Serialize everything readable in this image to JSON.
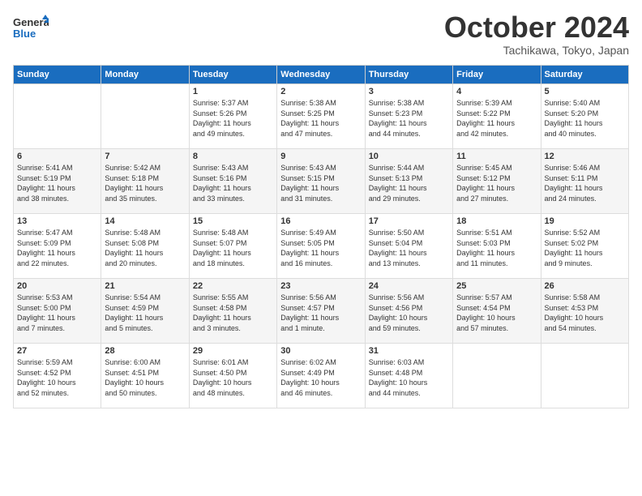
{
  "logo": {
    "general": "General",
    "blue": "Blue"
  },
  "header": {
    "month": "October 2024",
    "location": "Tachikawa, Tokyo, Japan"
  },
  "weekdays": [
    "Sunday",
    "Monday",
    "Tuesday",
    "Wednesday",
    "Thursday",
    "Friday",
    "Saturday"
  ],
  "weeks": [
    [
      {
        "day": "",
        "info": ""
      },
      {
        "day": "",
        "info": ""
      },
      {
        "day": "1",
        "info": "Sunrise: 5:37 AM\nSunset: 5:26 PM\nDaylight: 11 hours\nand 49 minutes."
      },
      {
        "day": "2",
        "info": "Sunrise: 5:38 AM\nSunset: 5:25 PM\nDaylight: 11 hours\nand 47 minutes."
      },
      {
        "day": "3",
        "info": "Sunrise: 5:38 AM\nSunset: 5:23 PM\nDaylight: 11 hours\nand 44 minutes."
      },
      {
        "day": "4",
        "info": "Sunrise: 5:39 AM\nSunset: 5:22 PM\nDaylight: 11 hours\nand 42 minutes."
      },
      {
        "day": "5",
        "info": "Sunrise: 5:40 AM\nSunset: 5:20 PM\nDaylight: 11 hours\nand 40 minutes."
      }
    ],
    [
      {
        "day": "6",
        "info": "Sunrise: 5:41 AM\nSunset: 5:19 PM\nDaylight: 11 hours\nand 38 minutes."
      },
      {
        "day": "7",
        "info": "Sunrise: 5:42 AM\nSunset: 5:18 PM\nDaylight: 11 hours\nand 35 minutes."
      },
      {
        "day": "8",
        "info": "Sunrise: 5:43 AM\nSunset: 5:16 PM\nDaylight: 11 hours\nand 33 minutes."
      },
      {
        "day": "9",
        "info": "Sunrise: 5:43 AM\nSunset: 5:15 PM\nDaylight: 11 hours\nand 31 minutes."
      },
      {
        "day": "10",
        "info": "Sunrise: 5:44 AM\nSunset: 5:13 PM\nDaylight: 11 hours\nand 29 minutes."
      },
      {
        "day": "11",
        "info": "Sunrise: 5:45 AM\nSunset: 5:12 PM\nDaylight: 11 hours\nand 27 minutes."
      },
      {
        "day": "12",
        "info": "Sunrise: 5:46 AM\nSunset: 5:11 PM\nDaylight: 11 hours\nand 24 minutes."
      }
    ],
    [
      {
        "day": "13",
        "info": "Sunrise: 5:47 AM\nSunset: 5:09 PM\nDaylight: 11 hours\nand 22 minutes."
      },
      {
        "day": "14",
        "info": "Sunrise: 5:48 AM\nSunset: 5:08 PM\nDaylight: 11 hours\nand 20 minutes."
      },
      {
        "day": "15",
        "info": "Sunrise: 5:48 AM\nSunset: 5:07 PM\nDaylight: 11 hours\nand 18 minutes."
      },
      {
        "day": "16",
        "info": "Sunrise: 5:49 AM\nSunset: 5:05 PM\nDaylight: 11 hours\nand 16 minutes."
      },
      {
        "day": "17",
        "info": "Sunrise: 5:50 AM\nSunset: 5:04 PM\nDaylight: 11 hours\nand 13 minutes."
      },
      {
        "day": "18",
        "info": "Sunrise: 5:51 AM\nSunset: 5:03 PM\nDaylight: 11 hours\nand 11 minutes."
      },
      {
        "day": "19",
        "info": "Sunrise: 5:52 AM\nSunset: 5:02 PM\nDaylight: 11 hours\nand 9 minutes."
      }
    ],
    [
      {
        "day": "20",
        "info": "Sunrise: 5:53 AM\nSunset: 5:00 PM\nDaylight: 11 hours\nand 7 minutes."
      },
      {
        "day": "21",
        "info": "Sunrise: 5:54 AM\nSunset: 4:59 PM\nDaylight: 11 hours\nand 5 minutes."
      },
      {
        "day": "22",
        "info": "Sunrise: 5:55 AM\nSunset: 4:58 PM\nDaylight: 11 hours\nand 3 minutes."
      },
      {
        "day": "23",
        "info": "Sunrise: 5:56 AM\nSunset: 4:57 PM\nDaylight: 11 hours\nand 1 minute."
      },
      {
        "day": "24",
        "info": "Sunrise: 5:56 AM\nSunset: 4:56 PM\nDaylight: 10 hours\nand 59 minutes."
      },
      {
        "day": "25",
        "info": "Sunrise: 5:57 AM\nSunset: 4:54 PM\nDaylight: 10 hours\nand 57 minutes."
      },
      {
        "day": "26",
        "info": "Sunrise: 5:58 AM\nSunset: 4:53 PM\nDaylight: 10 hours\nand 54 minutes."
      }
    ],
    [
      {
        "day": "27",
        "info": "Sunrise: 5:59 AM\nSunset: 4:52 PM\nDaylight: 10 hours\nand 52 minutes."
      },
      {
        "day": "28",
        "info": "Sunrise: 6:00 AM\nSunset: 4:51 PM\nDaylight: 10 hours\nand 50 minutes."
      },
      {
        "day": "29",
        "info": "Sunrise: 6:01 AM\nSunset: 4:50 PM\nDaylight: 10 hours\nand 48 minutes."
      },
      {
        "day": "30",
        "info": "Sunrise: 6:02 AM\nSunset: 4:49 PM\nDaylight: 10 hours\nand 46 minutes."
      },
      {
        "day": "31",
        "info": "Sunrise: 6:03 AM\nSunset: 4:48 PM\nDaylight: 10 hours\nand 44 minutes."
      },
      {
        "day": "",
        "info": ""
      },
      {
        "day": "",
        "info": ""
      }
    ]
  ]
}
